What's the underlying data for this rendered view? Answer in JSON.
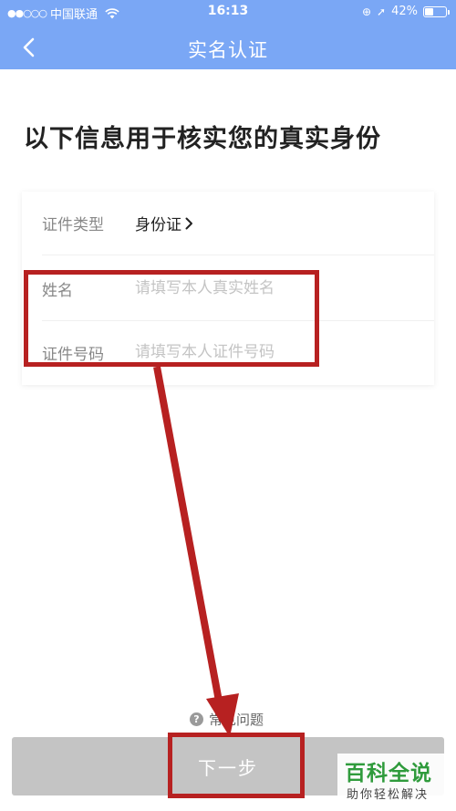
{
  "status_bar": {
    "carrier": "中国联通",
    "signal": "●●○○○",
    "time": "16:13",
    "battery_percent": "42%",
    "battery_level": 0.42,
    "icons": [
      "wifi-icon",
      "orientation-lock-icon",
      "location-icon",
      "battery-icon"
    ]
  },
  "nav": {
    "title": "实名认证",
    "back_icon": "chevron-left-icon",
    "background_color": "#7aa7f5"
  },
  "heading": "以下信息用于核实您的真实身份",
  "form": {
    "id_type": {
      "label": "证件类型",
      "value": "身份证"
    },
    "name": {
      "label": "姓名",
      "placeholder": "请填写本人真实姓名",
      "value": ""
    },
    "id_number": {
      "label": "证件号码",
      "placeholder": "请填写本人证件号码",
      "value": ""
    }
  },
  "faq": {
    "label": "常见问题",
    "icon": "question-icon"
  },
  "next_button": {
    "label": "下一步",
    "color": "#c4c4c4"
  },
  "annotation_color": "#b72121",
  "watermark": {
    "title": "百科全说",
    "subtitle": "助你轻松解决"
  }
}
